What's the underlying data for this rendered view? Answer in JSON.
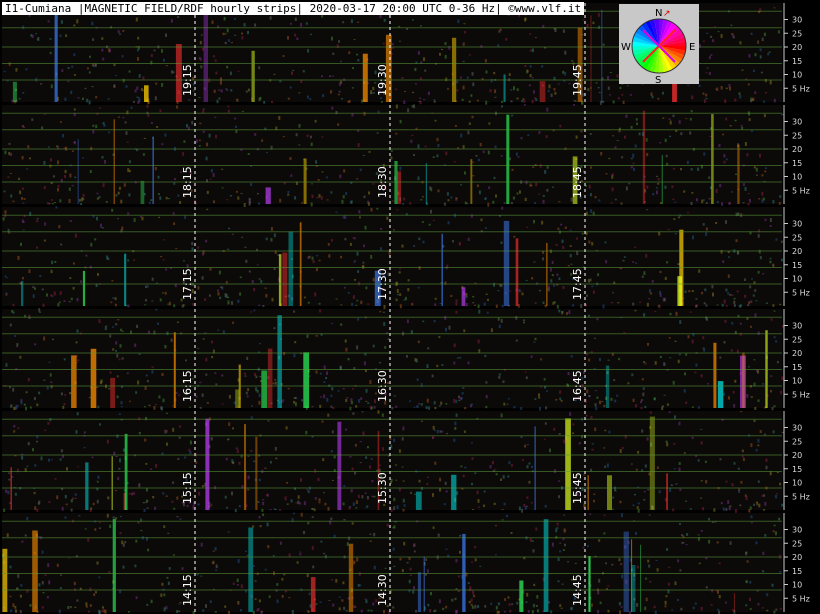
{
  "header": {
    "title": "I1-Cumiana |MAGNETIC FIELD/RDF hourly strips| 2020-03-17 20:00 UTC 0-36 Hz| ©www.vlf.it"
  },
  "compass": {
    "labels": {
      "n": "N",
      "s": "S",
      "e": "E",
      "w": "W"
    },
    "needle_colors": [
      "#ff2020",
      "#e000e0"
    ]
  },
  "chart_data": {
    "type": "heatmap",
    "title": "I1-Cumiana |MAGNETIC FIELD/RDF hourly strips| 2020-03-17 20:00 UTC 0-36 Hz| ©www.vlf.it",
    "y_range_hz": [
      0,
      36
    ],
    "y_ticks": [
      5,
      10,
      15,
      20,
      25,
      30
    ],
    "y_tick_labels": [
      "5 Hz",
      "10",
      "15",
      "20",
      "25",
      "30"
    ],
    "schumann_lines_hz": [
      8,
      14,
      20,
      27,
      33
    ],
    "strips": [
      {
        "hour": "19",
        "markers": [
          "19:15",
          "19:30",
          "19:45"
        ],
        "fill_fraction": 1.0
      },
      {
        "hour": "18",
        "markers": [
          "18:15",
          "18:30",
          "18:45"
        ],
        "fill_fraction": 1.0
      },
      {
        "hour": "17",
        "markers": [
          "17:15",
          "17:30",
          "17:45"
        ],
        "fill_fraction": 1.0
      },
      {
        "hour": "16",
        "markers": [
          "16:15",
          "16:30",
          "16:45"
        ],
        "fill_fraction": 1.0
      },
      {
        "hour": "15",
        "markers": [
          "15:15",
          "15:30",
          "15:45"
        ],
        "fill_fraction": 1.0
      },
      {
        "hour": "14",
        "markers": [
          "14:15",
          "14:30",
          "14:45"
        ],
        "fill_fraction": 1.0
      }
    ]
  }
}
